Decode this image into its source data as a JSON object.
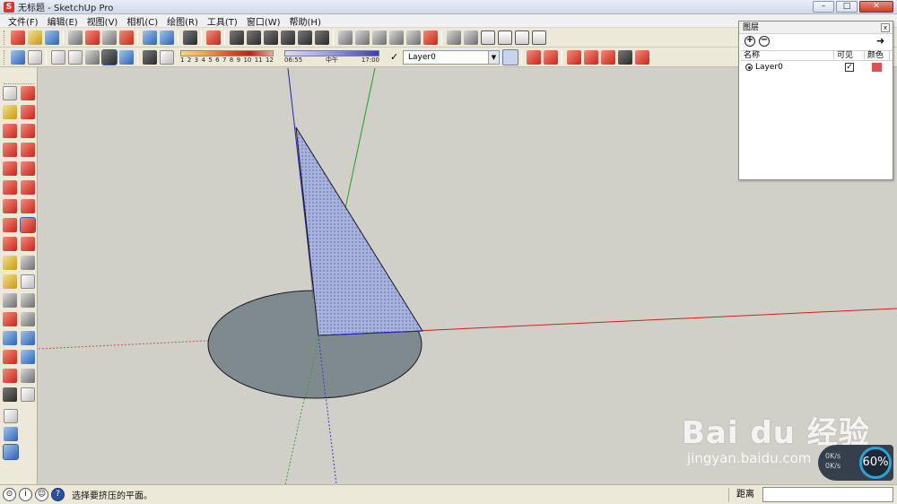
{
  "window": {
    "title": "无标题 - SketchUp Pro",
    "controls": {
      "minimize": "–",
      "maximize": "□",
      "close": "✕"
    }
  },
  "menu": [
    "文件(F)",
    "编辑(E)",
    "视图(V)",
    "相机(C)",
    "绘图(R)",
    "工具(T)",
    "窗口(W)",
    "帮助(H)"
  ],
  "toolbar": {
    "shadow_scale_labels": [
      "1",
      "2",
      "3",
      "4",
      "5",
      "6",
      "7",
      "8",
      "9",
      "10",
      "11",
      "12"
    ],
    "time_scale": {
      "start": "06:55",
      "mid": "中午",
      "end": "17:00"
    },
    "layer_selected": "Layer0"
  },
  "layers_panel": {
    "title": "图层",
    "close": "x",
    "add_icon": "+",
    "remove_icon": "−",
    "details_icon": "➜",
    "columns": {
      "name": "名称",
      "visible": "可见",
      "color": "颜色"
    },
    "rows": [
      {
        "name": "Layer0",
        "visible_mark": "✓",
        "color": "#e05050"
      }
    ]
  },
  "status": {
    "message": "选择要挤压的平面。",
    "measure_label": "距离",
    "icons": [
      "geo-location-icon",
      "credits-icon",
      "user-icon",
      "help-icon"
    ],
    "info_glyph": "i",
    "help_glyph": "?"
  },
  "watermark": {
    "brand": "Bai du 经验",
    "url": "jingyan.baidu.com",
    "speed": "60%",
    "rate_up": "0K/s",
    "rate_down": "0K/s"
  },
  "colors": {
    "axis_red": "#d02020",
    "axis_green": "#22a022",
    "axis_blue": "#2020c0",
    "face_front": "#9aa6d4",
    "face_back": "#7f8a8e",
    "background": "#d0cfc8",
    "layer_color": "#e05050"
  }
}
